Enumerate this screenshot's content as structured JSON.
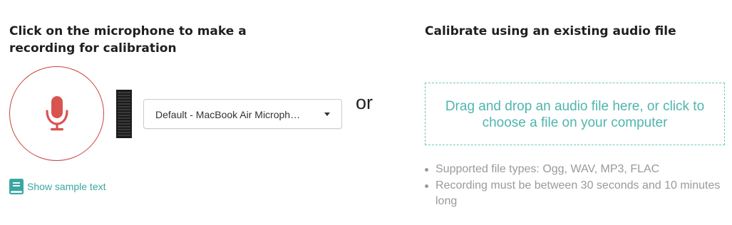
{
  "record": {
    "heading": "Click on the microphone to make a recording for calibration",
    "mic_icon": "microphone-icon",
    "device_select": {
      "selected": "Default - MacBook Air Microph…"
    },
    "sample_text_link": {
      "icon": "book-icon",
      "label": "Show sample text"
    }
  },
  "divider_text": "or",
  "upload": {
    "heading": "Calibrate using an existing audio file",
    "drop_zone_text": "Drag and drop an audio file here, or click to choose a file on your computer",
    "notes": [
      "Supported file types: Ogg, WAV, MP3, FLAC",
      "Recording must be between 30 seconds and 10 minutes long"
    ]
  },
  "colors": {
    "mic_accent": "#c9443f",
    "teal_accent": "#4fb5ae",
    "muted_text": "#9a9a9a"
  }
}
